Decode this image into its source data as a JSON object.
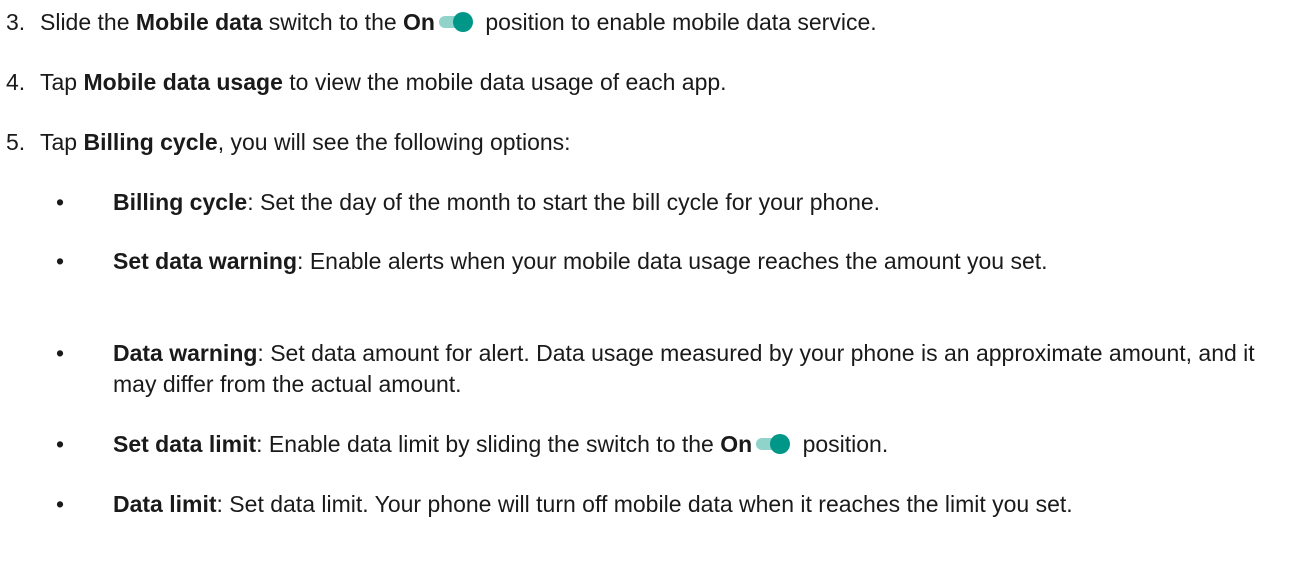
{
  "colors": {
    "toggle_track": "#8fd3cb",
    "toggle_thumb": "#009688",
    "text": "#1a1a1a"
  },
  "steps": [
    {
      "number": "3.",
      "pre": "Slide the ",
      "bold1": "Mobile data",
      "mid": " switch to the ",
      "bold2": "On",
      "post": " position to enable mobile data service.",
      "toggle_icon": "toggle-on-icon"
    },
    {
      "number": "4.",
      "pre": "Tap ",
      "bold1": "Mobile data usage",
      "post": " to view the mobile data usage of each app."
    },
    {
      "number": "5.",
      "pre": "Tap ",
      "bold1": "Billing cycle",
      "post": ", you will see the following options:"
    }
  ],
  "bullets": [
    {
      "symbol": "•",
      "term": "Billing cycle",
      "text": ": Set the day of the month to start the bill cycle for your phone."
    },
    {
      "symbol": "•",
      "term": "Set data warning",
      "text": ": Enable alerts when your mobile data usage reaches the amount you set."
    },
    {
      "symbol": "•",
      "term": "Data warning",
      "text": ": Set data amount for alert. Data usage measured by your phone is an approximate amount, and it may differ from the actual amount."
    },
    {
      "symbol": "•",
      "term": "Set data limit",
      "text": ": Enable data limit by sliding the switch to the ",
      "bold2": "On",
      "post": " position.",
      "toggle_icon": "toggle-on-icon"
    },
    {
      "symbol": "•",
      "term": "Data limit",
      "text": ": Set data limit. Your phone will turn off mobile data when it reaches the limit you set."
    }
  ]
}
